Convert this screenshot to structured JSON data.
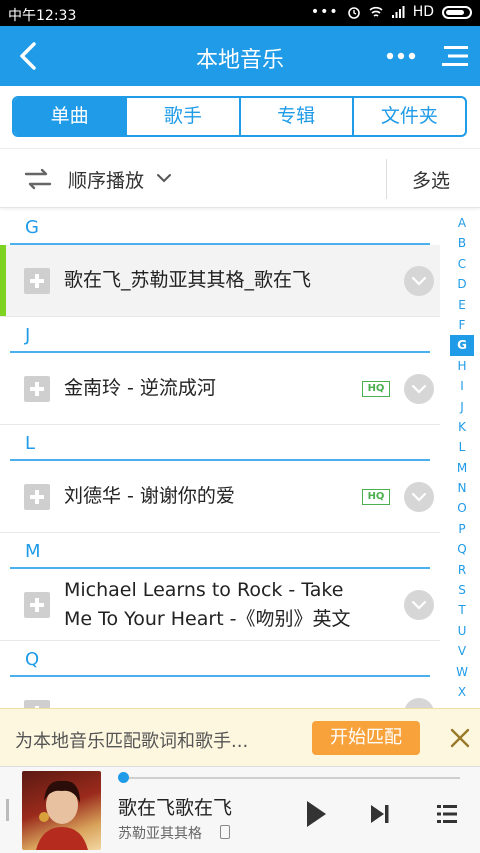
{
  "status_bar": {
    "time": "中午12:33",
    "network": "HD"
  },
  "header": {
    "title": "本地音乐"
  },
  "tabs": [
    {
      "label": "单曲"
    },
    {
      "label": "歌手"
    },
    {
      "label": "专辑"
    },
    {
      "label": "文件夹"
    }
  ],
  "toolbar": {
    "mode_label": "顺序播放",
    "multi_select_label": "多选"
  },
  "sections": [
    {
      "letter": "G",
      "songs": [
        {
          "title": "歌在飞_苏勒亚其其格_歌在飞",
          "hq": false,
          "active": true
        }
      ]
    },
    {
      "letter": "J",
      "songs": [
        {
          "title": "金南玲 - 逆流成河",
          "hq": true,
          "hq_label": "HQ",
          "active": false
        }
      ]
    },
    {
      "letter": "L",
      "songs": [
        {
          "title": "刘德华 - 谢谢你的爱",
          "hq": true,
          "hq_label": "HQ",
          "active": false
        }
      ]
    },
    {
      "letter": "M",
      "songs": [
        {
          "title_line1": "Michael Learns to Rock - Take",
          "title_line2": "Me To Your Heart -《吻别》英文",
          "hq": false,
          "active": false
        }
      ]
    },
    {
      "letter": "Q",
      "songs": []
    }
  ],
  "alphabet_index": {
    "letters": [
      "A",
      "B",
      "C",
      "D",
      "E",
      "F",
      "G",
      "H",
      "I",
      "J",
      "K",
      "L",
      "M",
      "N",
      "O",
      "P",
      "Q",
      "R",
      "S",
      "T",
      "U",
      "V",
      "W",
      "X"
    ],
    "active": "G"
  },
  "banner": {
    "text": "为本地音乐匹配歌词和歌手...",
    "button_label": "开始匹配"
  },
  "player": {
    "song": "歌在飞歌在飞",
    "artist": "苏勒亚其其格",
    "progress": 0.0
  },
  "colors": {
    "accent": "#1f9be8",
    "active_marker": "#7ed321",
    "hq": "#4caf50",
    "match_button": "#f7a23b"
  }
}
